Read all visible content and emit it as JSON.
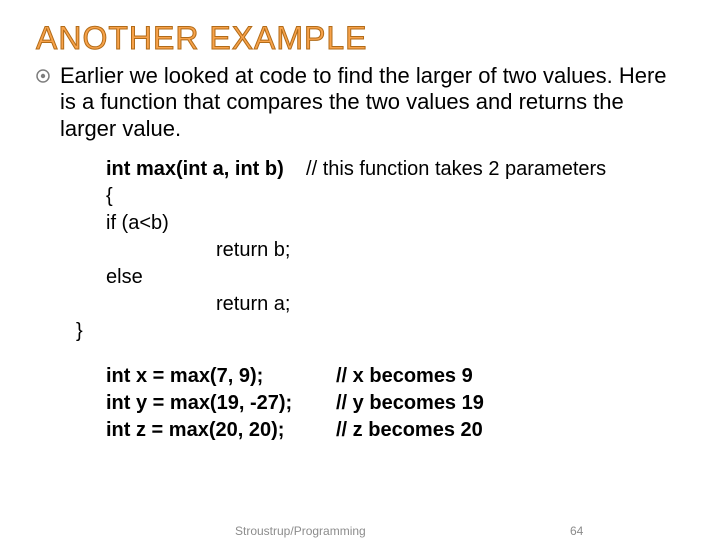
{
  "title": "ANOTHER EXAMPLE",
  "intro": "Earlier we looked at code to find the larger of two values. Here is a function that compares the two values and returns the larger value.",
  "code": {
    "sig": "int max(int a, int b)",
    "sig_comment": "// this function takes 2 parameters",
    "l1": "{",
    "l2": "if (a<b)",
    "l3": "return b;",
    "l4": "else",
    "l5": "return a;",
    "l6": "}"
  },
  "examples": [
    {
      "call": "int x = max(7, 9);",
      "comment": "// x becomes 9"
    },
    {
      "call": "int y = max(19, -27);",
      "comment": "// y becomes 19"
    },
    {
      "call": "int z = max(20, 20);",
      "comment": "// z becomes 20"
    }
  ],
  "footer": {
    "source": "Stroustrup/Programming",
    "page": "64"
  }
}
